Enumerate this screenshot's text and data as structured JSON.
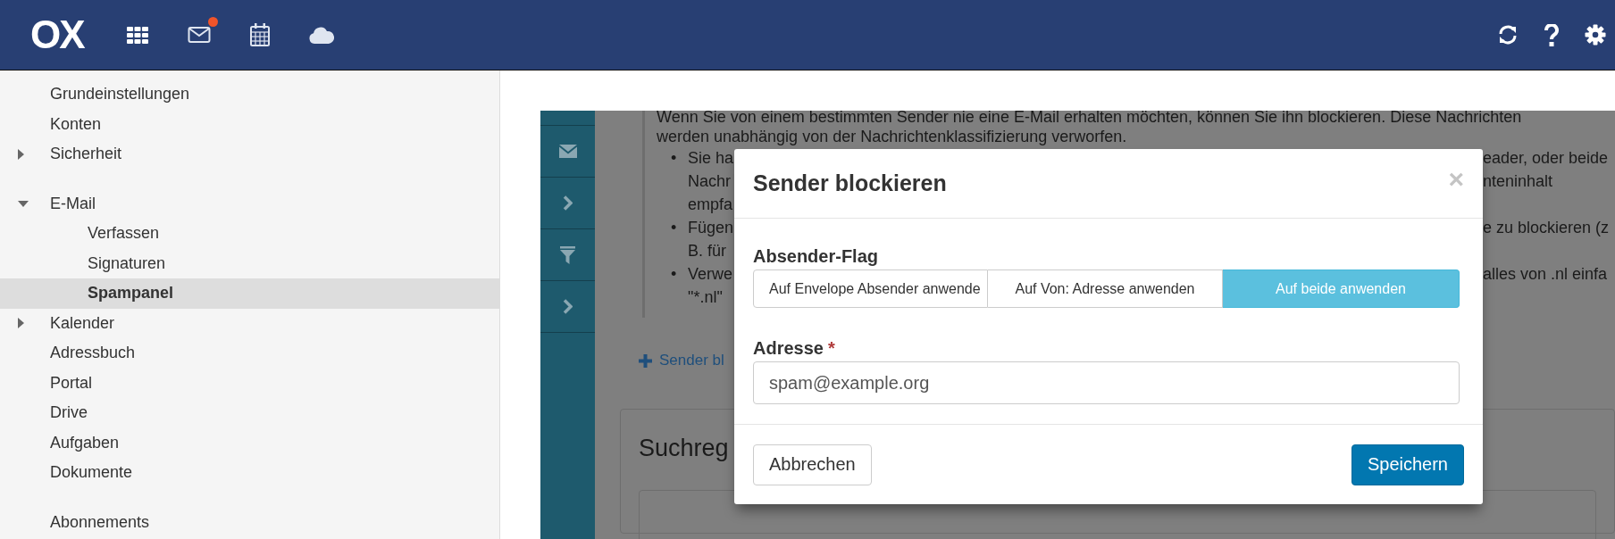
{
  "top_bar": {
    "logo": "OX",
    "apps": [
      {
        "kind": "grid",
        "badge": false
      },
      {
        "kind": "mail",
        "badge": true
      },
      {
        "kind": "calendar",
        "badge": false
      },
      {
        "kind": "cloud",
        "badge": false
      }
    ],
    "actions": [
      {
        "kind": "refresh"
      },
      {
        "kind": "help"
      },
      {
        "kind": "settings"
      }
    ]
  },
  "sidebar": {
    "groups": [
      {
        "items": [
          {
            "label": "Grundeinstellungen",
            "kind": "page",
            "selected": false
          },
          {
            "label": "Konten",
            "kind": "page",
            "selected": false
          },
          {
            "label": "Sicherheit",
            "kind": "folder",
            "expanded": false,
            "selected": false
          }
        ]
      },
      {
        "items": [
          {
            "label": "E-Mail",
            "kind": "folder",
            "expanded": true,
            "selected": false,
            "children": [
              {
                "label": "Verfassen",
                "kind": "page",
                "selected": false
              },
              {
                "label": "Signaturen",
                "kind": "page",
                "selected": false
              },
              {
                "label": "Spampanel",
                "kind": "page",
                "selected": true
              }
            ]
          },
          {
            "label": "Kalender",
            "kind": "folder",
            "expanded": false,
            "selected": false
          },
          {
            "label": "Adressbuch",
            "kind": "page",
            "selected": false
          },
          {
            "label": "Portal",
            "kind": "page",
            "selected": false
          },
          {
            "label": "Drive",
            "kind": "page",
            "selected": false
          },
          {
            "label": "Aufgaben",
            "kind": "page",
            "selected": false
          },
          {
            "label": "Dokumente",
            "kind": "page",
            "selected": false
          }
        ]
      },
      {
        "items": [
          {
            "label": "Abonnements",
            "kind": "page",
            "selected": false
          }
        ]
      }
    ]
  },
  "panel": {
    "nav": [
      {
        "kind": "mail"
      },
      {
        "kind": "chevron"
      },
      {
        "kind": "filter"
      },
      {
        "kind": "chevron"
      }
    ],
    "intro": [
      "Wenn Sie von einem bestimmten Sender nie eine E-Mail erhalten möchten, können Sie ihn blockieren. Diese Nachrichten",
      "werden unabhängig von der Nachrichtenklassifizierung verworfen."
    ],
    "bullets": [
      {
        "marker": "•",
        "lines": [
          {
            "left": "Sie ha",
            "right": "eader, oder beide"
          },
          {
            "left": "Nachr",
            "right": "nteninhalt"
          },
          {
            "left": "empfa"
          }
        ]
      },
      {
        "marker": "•",
        "lines": [
          {
            "left": "Fügen",
            "right": "e zu blockieren (z"
          },
          {
            "left": "B. für"
          }
        ]
      },
      {
        "marker": "•",
        "lines": [
          {
            "left": "Verwe",
            "right": "alles von .nl einfa"
          },
          {
            "left": "\"*.nl\""
          }
        ]
      }
    ],
    "add_link": "Sender bl",
    "section_title": "Suchreg"
  },
  "dialog": {
    "title": "Sender blockieren",
    "close": "×",
    "flag_label": "Absender-Flag",
    "flag_options": [
      {
        "label": "Auf Envelope Absender anwende",
        "selected": false
      },
      {
        "label": "Auf Von: Adresse anwenden",
        "selected": false
      },
      {
        "label": "Auf beide anwenden",
        "selected": true
      }
    ],
    "address_label": "Adresse",
    "required_mark": "*",
    "address_value": "spam@example.org",
    "cancel": "Abbrechen",
    "save": "Speichern"
  }
}
